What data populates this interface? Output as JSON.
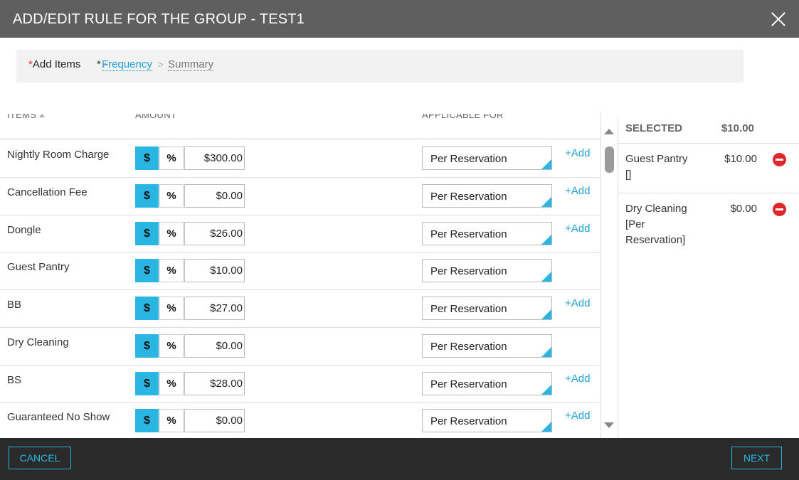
{
  "title": "ADD/EDIT RULE FOR THE GROUP - TEST1",
  "breadcrumb": {
    "required_mark": "*",
    "step1": "Add Items",
    "sep": ">",
    "step2": "Frequency",
    "step3": "Summary"
  },
  "columns": {
    "items": "ITEMS",
    "amount": "AMOUNT",
    "applicable": "APPLICABLE FOR"
  },
  "rows": [
    {
      "name": "Nightly Room Charge",
      "dollar": "$",
      "pct": "%",
      "amount": "$300.00",
      "applicable": "Per Reservation",
      "add": "+Add"
    },
    {
      "name": "Cancellation Fee",
      "dollar": "$",
      "pct": "%",
      "amount": "$0.00",
      "applicable": "Per Reservation",
      "add": "+Add"
    },
    {
      "name": "Dongle",
      "dollar": "$",
      "pct": "%",
      "amount": "$26.00",
      "applicable": "Per Reservation",
      "add": "+Add"
    },
    {
      "name": "Guest Pantry",
      "dollar": "$",
      "pct": "%",
      "amount": "$10.00",
      "applicable": "Per Reservation",
      "add": ""
    },
    {
      "name": "BB",
      "dollar": "$",
      "pct": "%",
      "amount": "$27.00",
      "applicable": "Per Reservation",
      "add": "+Add"
    },
    {
      "name": "Dry Cleaning",
      "dollar": "$",
      "pct": "%",
      "amount": "$0.00",
      "applicable": "Per Reservation",
      "add": ""
    },
    {
      "name": "BS",
      "dollar": "$",
      "pct": "%",
      "amount": "$28.00",
      "applicable": "Per Reservation",
      "add": "+Add"
    },
    {
      "name": "Guaranteed No Show",
      "dollar": "$",
      "pct": "%",
      "amount": "$0.00",
      "applicable": "Per Reservation",
      "add": "+Add"
    }
  ],
  "selected": {
    "label": "SELECTED",
    "total": "$10.00",
    "items": [
      {
        "name": "Guest Pantry []",
        "amount": "$10.00"
      },
      {
        "name": "Dry Cleaning [Per Reservation]",
        "amount": "$0.00"
      }
    ]
  },
  "footer": {
    "cancel": "CANCEL",
    "next": "NEXT"
  },
  "colors": {
    "accent": "#29b6e3",
    "link": "#1e9fd6",
    "remove": "#e0262b",
    "titlebar": "#5f5f5f",
    "footer": "#2a2a2a"
  }
}
